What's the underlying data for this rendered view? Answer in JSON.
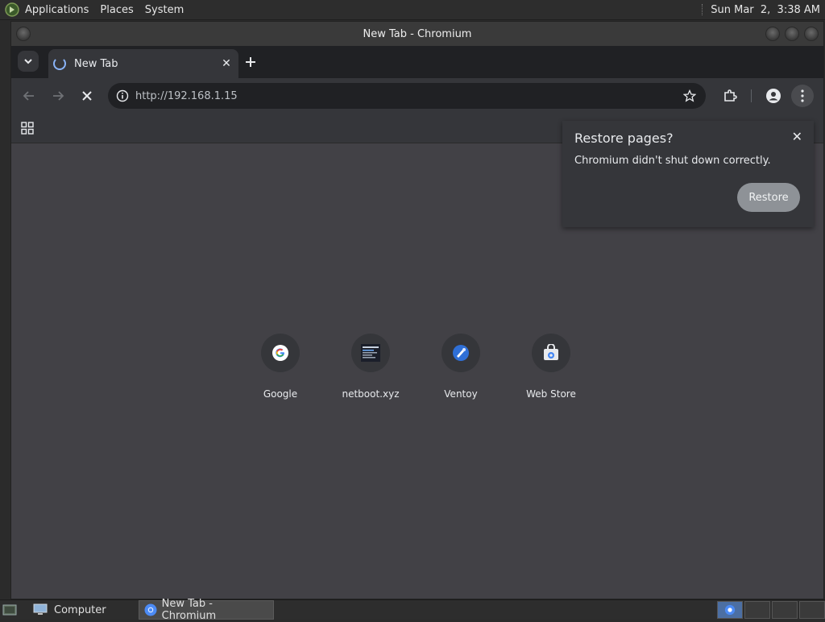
{
  "topbar": {
    "menus": [
      "Applications",
      "Places",
      "System"
    ],
    "clock": "Sun Mar  2,  3:38 AM"
  },
  "window": {
    "title": "New Tab - Chromium"
  },
  "tabs": [
    {
      "label": "New Tab",
      "loading": true
    }
  ],
  "omnibox": {
    "url": "http://192.168.1.15"
  },
  "shortcuts": [
    {
      "label": "Google",
      "icon": "google-icon"
    },
    {
      "label": "netboot.xyz",
      "icon": "netboot-icon"
    },
    {
      "label": "Ventoy",
      "icon": "ventoy-icon"
    },
    {
      "label": "Web Store",
      "icon": "web-store-icon"
    }
  ],
  "restore_bubble": {
    "title": "Restore pages?",
    "message": "Chromium didn't shut down correctly.",
    "button": "Restore"
  },
  "taskbar": {
    "items": [
      {
        "label": "Computer",
        "active": false
      },
      {
        "label": "New Tab - Chromium",
        "active": true
      }
    ]
  },
  "colors": {
    "accent": "#8ab4f8",
    "page_bg": "#424146",
    "toolbar_bg": "#35363a"
  }
}
